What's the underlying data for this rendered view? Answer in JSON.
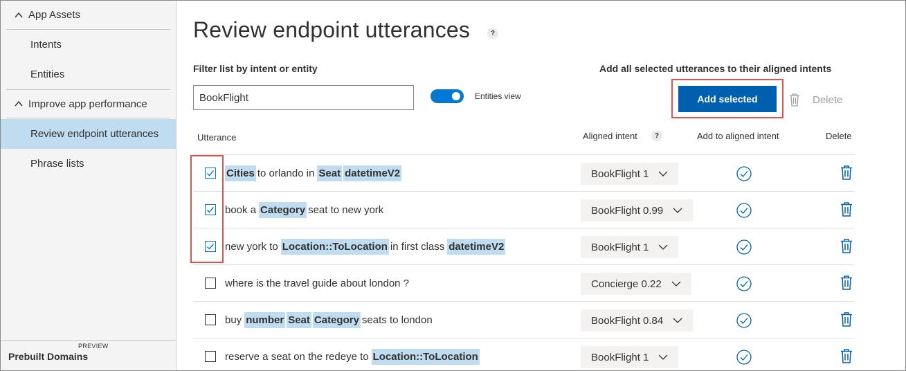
{
  "sidebar": {
    "app_assets": "App Assets",
    "intents": "Intents",
    "entities": "Entities",
    "improve": "Improve app performance",
    "review": "Review endpoint utterances",
    "phrase_lists": "Phrase lists",
    "prebuilt": "Prebuilt Domains",
    "preview": "PREVIEW"
  },
  "main": {
    "title": "Review endpoint utterances",
    "help": "?",
    "filter_label": "Filter list by intent or entity",
    "filter_value": "BookFlight",
    "entities_view_label": "Entities view",
    "add_all_label": "Add all selected utterances to their aligned intents",
    "add_selected": "Add selected",
    "delete": "Delete"
  },
  "table": {
    "headers": {
      "utterance": "Utterance",
      "aligned_intent": "Aligned intent",
      "aligned_help": "?",
      "add_to_aligned": "Add to aligned intent",
      "delete": "Delete"
    },
    "rows": [
      {
        "checked": true,
        "segments": [
          {
            "e": "Cities"
          },
          {
            "t": "to orlando in"
          },
          {
            "e": "Seat"
          },
          {
            "e": "datetimeV2"
          }
        ],
        "intent": "BookFlight 1"
      },
      {
        "checked": true,
        "segments": [
          {
            "t": "book a"
          },
          {
            "e": "Category"
          },
          {
            "t": "seat to new york"
          }
        ],
        "intent": "BookFlight 0.99"
      },
      {
        "checked": true,
        "segments": [
          {
            "t": "new york to"
          },
          {
            "e": "Location::ToLocation"
          },
          {
            "t": "in first class"
          },
          {
            "e": "datetimeV2"
          }
        ],
        "intent": "BookFlight 1"
      },
      {
        "checked": false,
        "segments": [
          {
            "t": "where is the travel guide about london ?"
          }
        ],
        "intent": "Concierge 0.22"
      },
      {
        "checked": false,
        "segments": [
          {
            "t": "buy"
          },
          {
            "e": "number"
          },
          {
            "e": "Seat"
          },
          {
            "e": "Category"
          },
          {
            "t": "seats to london"
          }
        ],
        "intent": "BookFlight 0.84"
      },
      {
        "checked": false,
        "segments": [
          {
            "t": "reserve a seat on the redeye to"
          },
          {
            "e": "Location::ToLocation"
          }
        ],
        "intent": "BookFlight 1"
      }
    ]
  },
  "colors": {
    "accent": "#0078d4",
    "button": "#0060b0",
    "entity_highlight": "#bfdcf0",
    "annotation": "#d9534f"
  }
}
